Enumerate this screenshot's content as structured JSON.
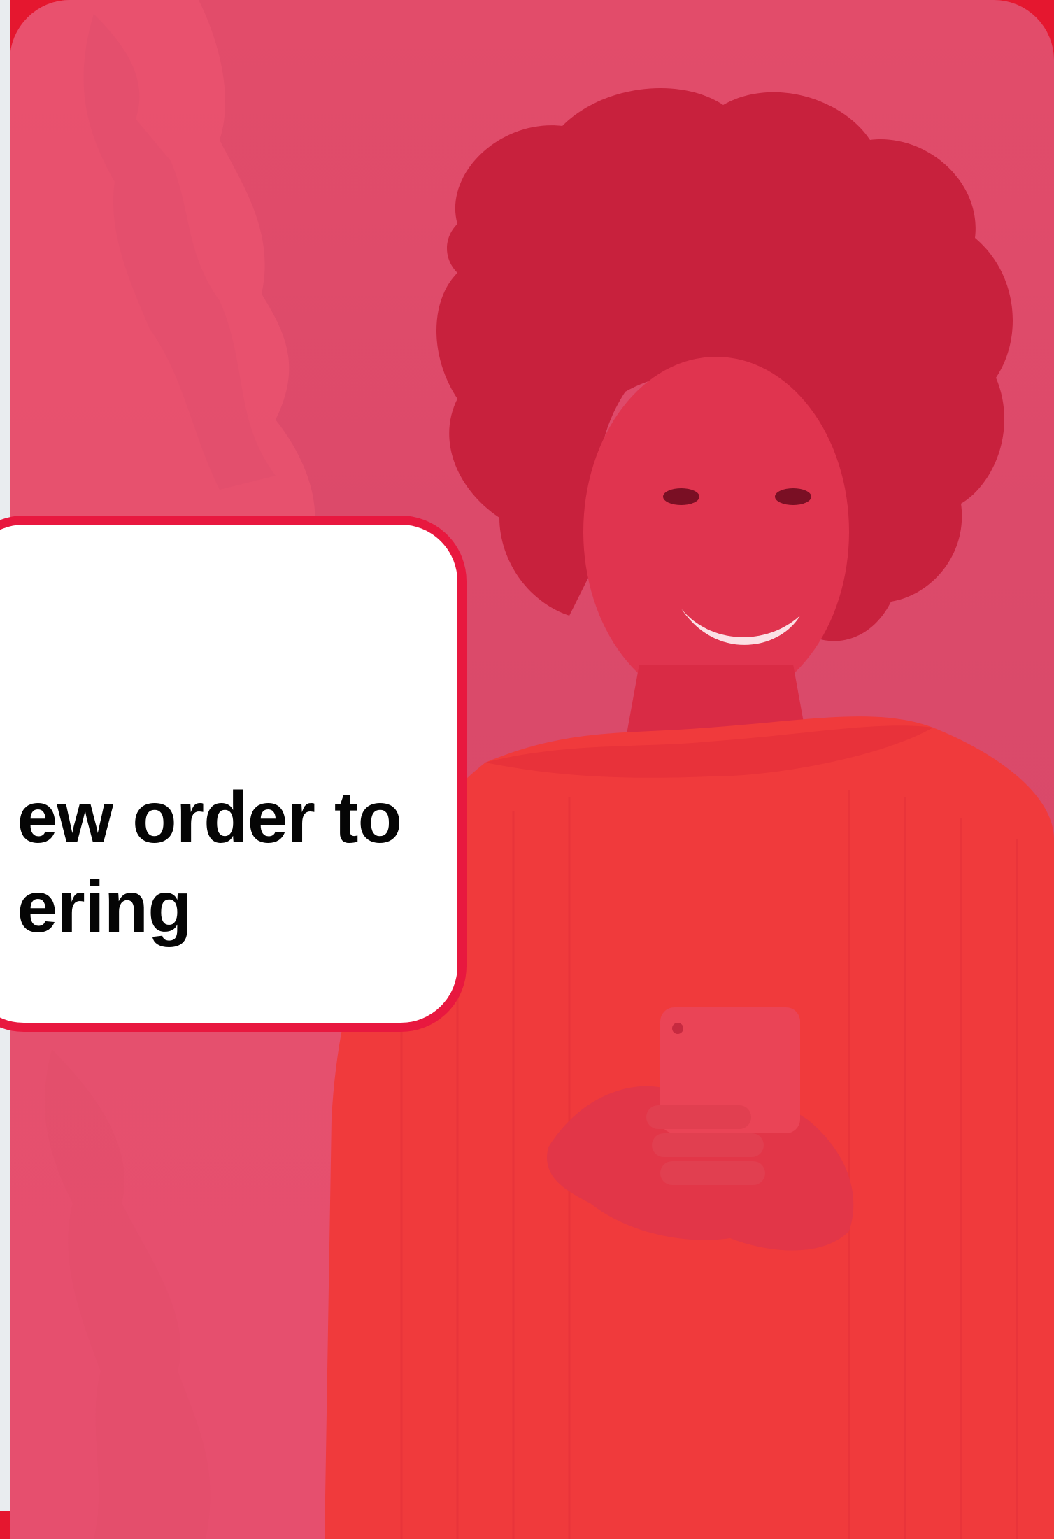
{
  "hero": {
    "headline_line1": "ew order to",
    "headline_line2": "ering",
    "image_subject": "smiling-woman-with-phone"
  },
  "colors": {
    "brand_red": "#e8183f",
    "overlay_pink": "#dc4a6a",
    "card_bg": "#ffffff",
    "text": "#050505"
  }
}
